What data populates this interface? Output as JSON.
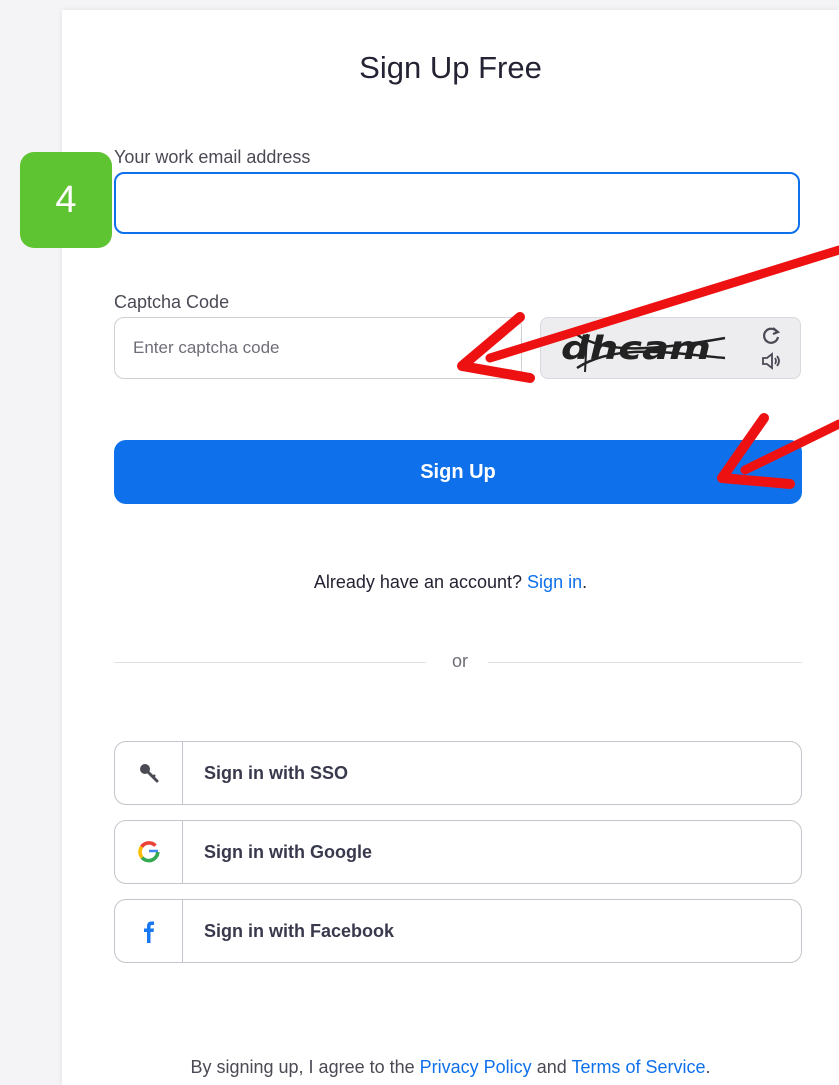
{
  "form": {
    "title": "Sign Up Free",
    "email_label": "Your work email address",
    "email_value": "",
    "captcha_label": "Captcha Code",
    "captcha_placeholder": "Enter captcha code",
    "captcha_image_text": "dhcam",
    "signup_button": "Sign Up",
    "already_text": "Already have an account?",
    "signin_link": "Sign in",
    "signin_period": ".",
    "or_text": "or"
  },
  "social_buttons": [
    {
      "label": "Sign in with SSO",
      "icon": "key-icon"
    },
    {
      "label": "Sign in with Google",
      "icon": "google-icon"
    },
    {
      "label": "Sign in with Facebook",
      "icon": "facebook-icon"
    }
  ],
  "footer": {
    "prefix": "By signing up, I agree to the",
    "privacy": "Privacy Policy",
    "and": "and",
    "terms": "Terms of Service",
    "suffix": "."
  },
  "annotation": {
    "step_number": "4",
    "badge_color": "#5fc431",
    "arrow_color": "#ee1111"
  },
  "colors": {
    "accent": "#0e71eb"
  }
}
